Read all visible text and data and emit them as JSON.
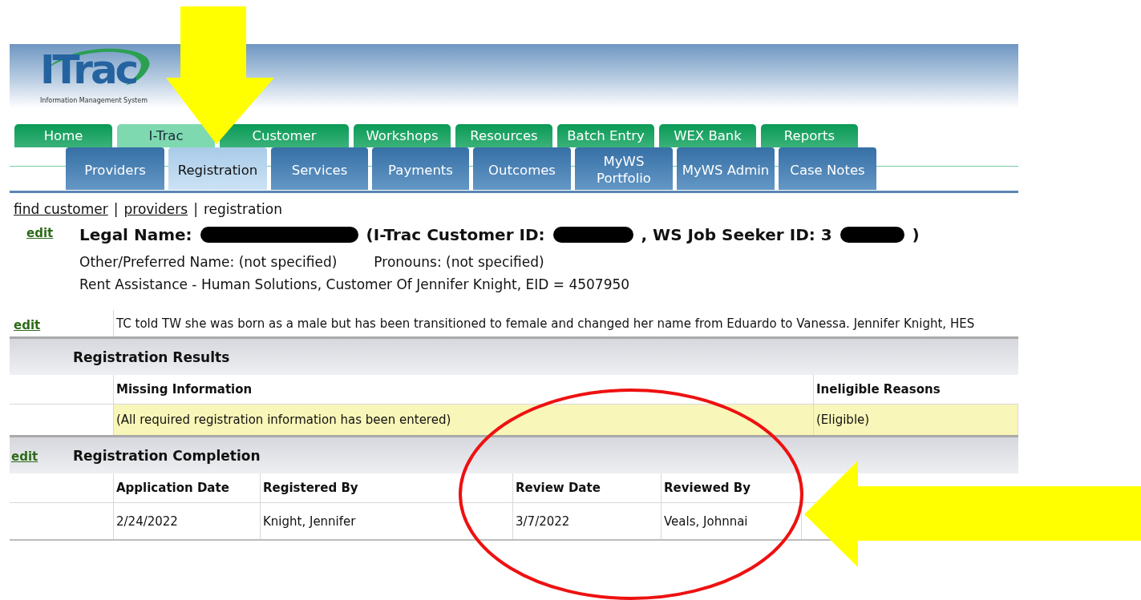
{
  "logo": {
    "name": "ITrac",
    "tagline": "Information Management System"
  },
  "main_tabs": [
    {
      "label": "Home",
      "selected": false
    },
    {
      "label": "I-Trac",
      "selected": true
    },
    {
      "label": "Customer",
      "selected": false
    },
    {
      "label": "Workshops",
      "selected": false
    },
    {
      "label": "Resources",
      "selected": false
    },
    {
      "label": "Batch Entry",
      "selected": false
    },
    {
      "label": "WEX Bank",
      "selected": false
    },
    {
      "label": "Reports",
      "selected": false
    }
  ],
  "sub_tabs": [
    {
      "label": "Providers",
      "selected": false
    },
    {
      "label": "Registration",
      "selected": true
    },
    {
      "label": "Services",
      "selected": false
    },
    {
      "label": "Payments",
      "selected": false
    },
    {
      "label": "Outcomes",
      "selected": false
    },
    {
      "label": "MyWS Portfolio",
      "selected": false
    },
    {
      "label": "MyWS Admin",
      "selected": false
    },
    {
      "label": "Case Notes",
      "selected": false
    }
  ],
  "breadcrumb": [
    {
      "label": "find customer",
      "kind": "link"
    },
    {
      "label": "|",
      "kind": "separator"
    },
    {
      "label": "providers",
      "kind": "link"
    },
    {
      "label": "|",
      "kind": "separator"
    },
    {
      "label": "registration",
      "kind": "current"
    }
  ],
  "customer": {
    "edit": "edit",
    "heading": [
      {
        "kind": "text",
        "text": "Legal Name:"
      },
      {
        "kind": "redacted"
      },
      {
        "kind": "text",
        "text": "(I-Trac Customer ID:"
      },
      {
        "kind": "redacted"
      },
      {
        "kind": "text",
        "text": ", WS Job Seeker ID: 3"
      },
      {
        "kind": "redacted"
      },
      {
        "kind": "text",
        "text": ")"
      }
    ],
    "preferred_name": "Other/Preferred Name: (not specified)",
    "pronouns": "Pronouns: (not specified)",
    "program": "Rent Assistance - Human Solutions, Customer Of Jennifer Knight, EID = 4507950"
  },
  "note": {
    "edit": "edit",
    "text": "TC told TW she was born as a male but has been transitioned to female and changed her name from Eduardo to Vanessa. Jennifer Knight, HES"
  },
  "registration_results": {
    "title": "Registration Results",
    "columns": [
      "Missing Information",
      "Ineligible Reasons"
    ],
    "rows": [
      [
        "(All required registration information has been entered)",
        "(Eligible)"
      ]
    ]
  },
  "registration_completion": {
    "edit": "edit",
    "title": "Registration Completion",
    "columns": [
      "Application Date",
      "Registered By",
      "Review Date",
      "Reviewed By"
    ],
    "rows": [
      [
        "2/24/2022",
        "Knight, Jennifer",
        "3/7/2022",
        "Veals, Johnnai"
      ]
    ]
  }
}
